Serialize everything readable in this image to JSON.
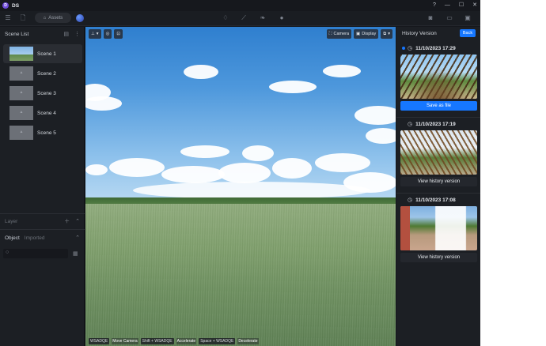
{
  "app": {
    "title": "DS",
    "logo_letter": "D"
  },
  "window_controls": [
    "?",
    "—",
    "☐",
    "✕"
  ],
  "toolbar": {
    "assets_label": "Assets"
  },
  "left_panel": {
    "scene_list_title": "Scene List",
    "scenes": [
      {
        "label": "Scene 1",
        "active": true
      },
      {
        "label": "Scene 2",
        "active": false
      },
      {
        "label": "Scene 3",
        "active": false
      },
      {
        "label": "Scene 4",
        "active": false
      },
      {
        "label": "Scene 5",
        "active": false
      }
    ],
    "layer_title": "Layer",
    "object_tab": "Object",
    "imported_tab": "Imported"
  },
  "viewport": {
    "camera_label": "Camera",
    "display_label": "Display",
    "hints": [
      {
        "key": "WSADQE",
        "text": "Move Camera"
      },
      {
        "key": "Shift + WSADQE",
        "text": "Accelerate"
      },
      {
        "key": "Space + WSADQE",
        "text": "Decelerate"
      }
    ]
  },
  "right_panel": {
    "title": "History Version",
    "back_label": "Back",
    "versions": [
      {
        "time": "11/10/2023 17:29",
        "button": "Save as file",
        "current": true
      },
      {
        "time": "11/10/2023 17:19",
        "button": "View history version",
        "current": false
      },
      {
        "time": "11/10/2023 17:08",
        "button": "View history version",
        "current": false
      }
    ]
  },
  "colors": {
    "accent": "#1677ff",
    "logo": "#6e4bd8",
    "background": "#16181d"
  }
}
